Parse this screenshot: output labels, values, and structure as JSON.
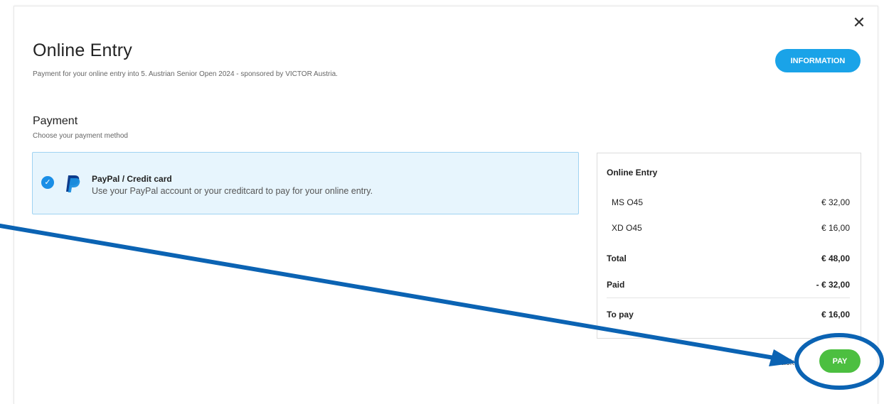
{
  "dialog": {
    "close_glyph": "✕",
    "title": "Online Entry",
    "subtitle": "Payment for your online entry into 5. Austrian Senior Open 2024 - sponsored by VICTOR Austria.",
    "info_button": "INFORMATION"
  },
  "payment": {
    "title": "Payment",
    "subtitle": "Choose your payment method",
    "methods": [
      {
        "name": "PayPal / Credit card",
        "description": "Use your PayPal account or your creditcard to pay for your online entry.",
        "selected": true,
        "icon": "paypal-icon"
      }
    ]
  },
  "summary": {
    "title": "Online Entry",
    "items": [
      {
        "label": "MS O45",
        "value": "€ 32,00"
      },
      {
        "label": "XD O45",
        "value": "€ 16,00"
      }
    ],
    "total_label": "Total",
    "total_value": "€ 48,00",
    "paid_label": "Paid",
    "paid_value": "- € 32,00",
    "to_pay_label": "To pay",
    "to_pay_value": "€ 16,00"
  },
  "actions": {
    "back_label": "Back",
    "pay_button": "PAY"
  },
  "colors": {
    "info_button": "#1aa3e8",
    "pay_button": "#4cbf40",
    "selected_bg": "#e7f5fd",
    "annotation": "#0b63b3"
  }
}
